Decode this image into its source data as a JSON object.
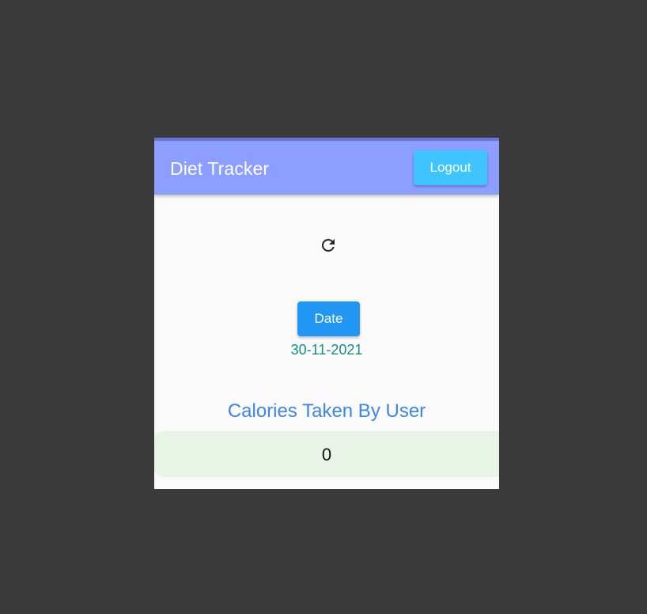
{
  "app": {
    "title": "Diet Tracker"
  },
  "header": {
    "logout_label": "Logout"
  },
  "main": {
    "refresh_icon": "refresh-icon",
    "date_button_label": "Date",
    "selected_date": "30-11-2021",
    "calories_title": "Calories Taken By User",
    "calories_value": "0"
  },
  "colors": {
    "app_bar": "#8c9eff",
    "logout_button": "#40c4ff",
    "date_button": "#2196f3",
    "date_text": "#11917f",
    "calories_title": "#3d86e6",
    "calories_box": "#e7f4e6"
  }
}
